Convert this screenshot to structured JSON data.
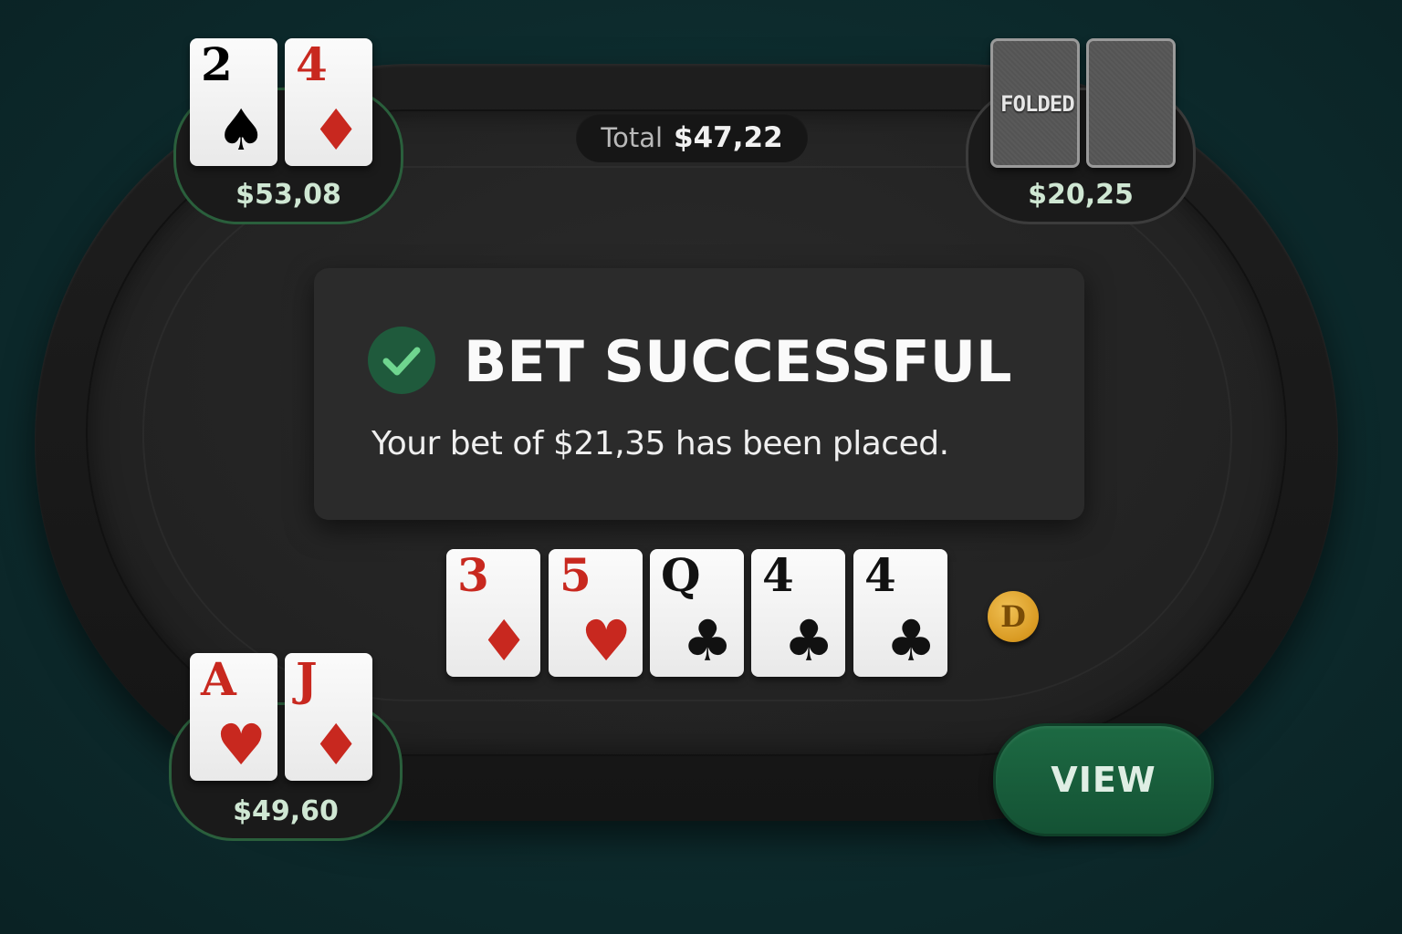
{
  "pot": {
    "label": "Total",
    "value": "$47,22"
  },
  "seats": {
    "top_left": {
      "stack": "$53,08",
      "cards": [
        {
          "rank": "2",
          "suit": "♠",
          "color": "black"
        },
        {
          "rank": "4",
          "suit": "♦",
          "color": "red"
        }
      ]
    },
    "top_right": {
      "stack": "$20,25",
      "status": "FOLDED"
    },
    "bottom_left": {
      "stack": "$49,60",
      "cards": [
        {
          "rank": "A",
          "suit": "♥",
          "color": "red"
        },
        {
          "rank": "J",
          "suit": "♦",
          "color": "red"
        }
      ]
    }
  },
  "toast": {
    "title": "BET SUCCESSFUL",
    "message": "Your bet of $21,35 has been placed.",
    "icon": "check-circle-icon",
    "icon_color": "#1f5a3c",
    "check_color": "#6fd58f"
  },
  "board": [
    {
      "rank": "3",
      "suit": "♦",
      "color": "red"
    },
    {
      "rank": "5",
      "suit": "♥",
      "color": "red"
    },
    {
      "rank": "Q",
      "suit": "♣",
      "color": "black"
    },
    {
      "rank": "4",
      "suit": "♣",
      "color": "black"
    },
    {
      "rank": "4",
      "suit": "♣",
      "color": "black"
    }
  ],
  "dealer_button": {
    "label": "D"
  },
  "view_button": {
    "label": "VIEW",
    "color": "#1d6a43"
  }
}
